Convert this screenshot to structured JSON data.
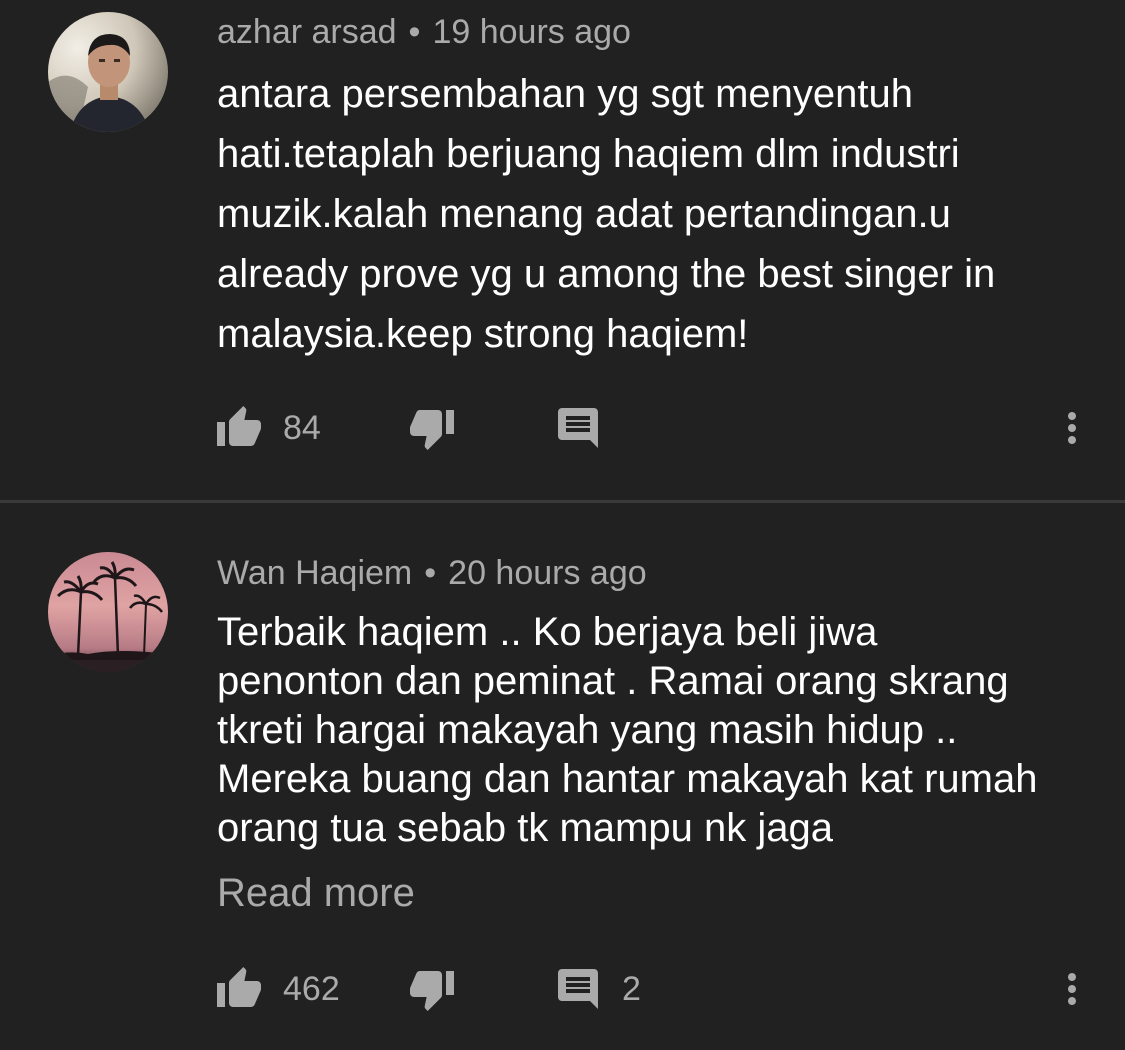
{
  "comments": [
    {
      "author": "azhar arsad",
      "separator": "•",
      "time": "19 hours ago",
      "text_lines": [
        "antara persembahan yg sgt menyentuh",
        "hati.tetaplah berjuang haqiem dlm industri",
        "muzik.kalah menang adat pertandingan.u",
        "already prove yg u among the best singer in",
        "malaysia.keep strong haqiem!"
      ],
      "likes": "84",
      "replies": ""
    },
    {
      "author": "Wan Haqiem",
      "separator": "•",
      "time": "20 hours ago",
      "text_lines": [
        "Terbaik haqiem .. Ko berjaya beli jiwa",
        "penonton dan peminat . Ramai orang skrang",
        "tkreti hargai makayah yang masih hidup ..",
        "Mereka buang dan hantar makayah kat rumah",
        "orang tua sebab tk mampu nk jaga"
      ],
      "read_more": "Read more",
      "likes": "462",
      "replies": "2"
    }
  ],
  "icons": {
    "like": "thumb-up-icon",
    "dislike": "thumb-down-icon",
    "reply": "comment-icon",
    "more": "more-vert-icon"
  },
  "colors": {
    "background": "#212121",
    "primary_text": "#ffffff",
    "secondary_text": "#aaaaaa",
    "icon": "#aaaaaa",
    "divider": "#3a3a3a"
  }
}
